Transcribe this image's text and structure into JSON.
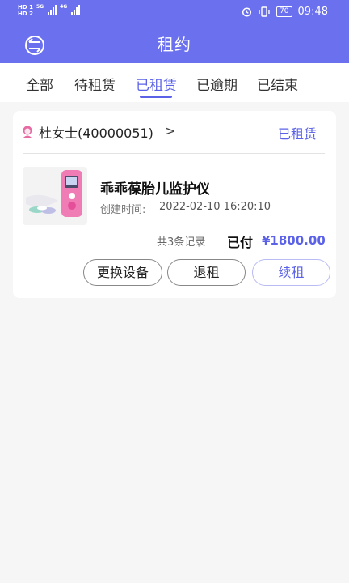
{
  "status_bar": {
    "time": "09:48",
    "battery": "70",
    "hd1": "HD 1",
    "hd2": "HD 2",
    "net1": "5G",
    "net2": "4G"
  },
  "header": {
    "title": "租约"
  },
  "tabs": [
    {
      "label": "全部"
    },
    {
      "label": "待租赁"
    },
    {
      "label": "已租赁",
      "active": true
    },
    {
      "label": "已逾期"
    },
    {
      "label": "已结束"
    }
  ],
  "order": {
    "customer": "杜女士(40000051)",
    "status": "已租赁",
    "product_name": "乖乖葆胎儿监护仪",
    "created_label": "创建时间:",
    "created_value": "2022-02-10 16:20:10",
    "records": "共3条记录",
    "paid_label": "已付",
    "paid_amount": "¥1800.00",
    "actions": [
      {
        "label": "更换设备"
      },
      {
        "label": "退租"
      },
      {
        "label": "续租"
      }
    ]
  },
  "colors": {
    "primary": "#6b71ee",
    "accent": "#5b62e8"
  }
}
